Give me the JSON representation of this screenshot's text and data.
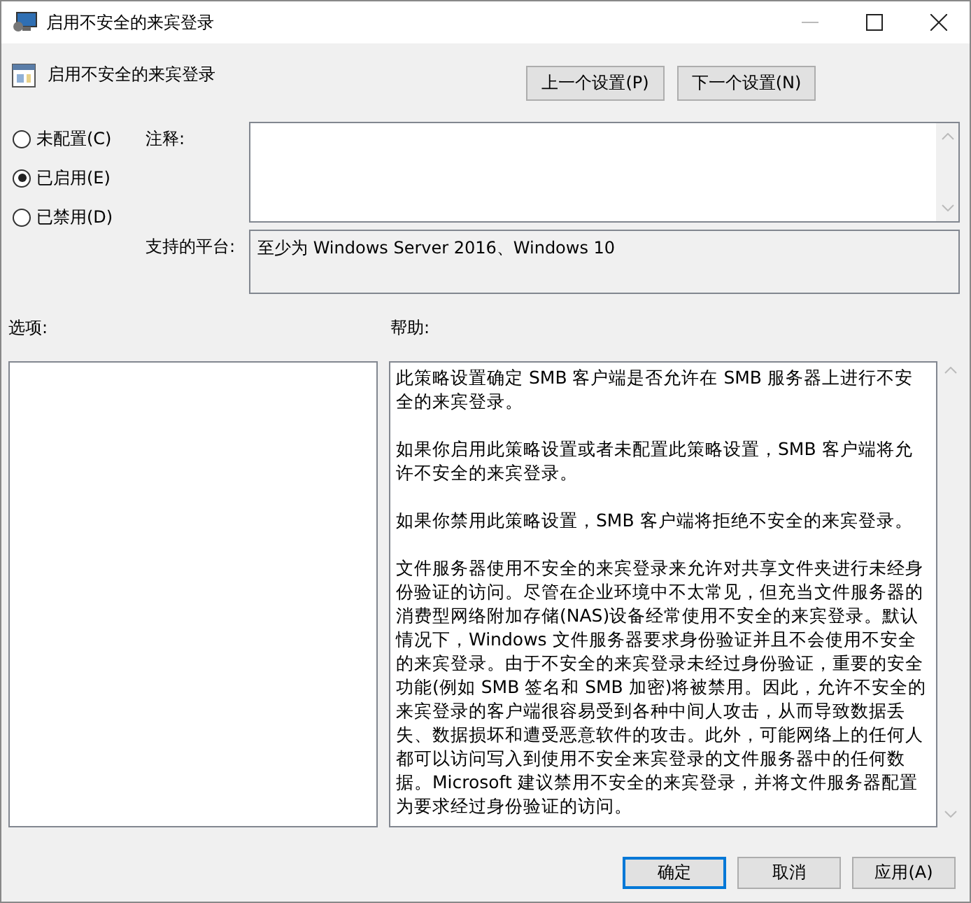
{
  "window": {
    "title": "启用不安全的来宾登录"
  },
  "header": {
    "title": "启用不安全的来宾登录",
    "buttons": [
      "上一个设置(P)",
      "下一个设置(N)"
    ]
  },
  "state_options": [
    {
      "label": "未配置(C)",
      "selected": false
    },
    {
      "label": "已启用(E)",
      "selected": true
    },
    {
      "label": "已禁用(D)",
      "selected": false
    }
  ],
  "comment": {
    "label": "注释:"
  },
  "platform": {
    "label": "支持的平台:",
    "value": "至少为 Windows Server 2016、Windows 10"
  },
  "options": {
    "label": "选项:"
  },
  "help": {
    "label": "帮助:",
    "paragraphs": [
      "此策略设置确定 SMB 客户端是否允许在 SMB 服务器上进行不安全的来宾登录。",
      "如果你启用此策略设置或者未配置此策略设置，SMB 客户端将允许不安全的来宾登录。",
      "如果你禁用此策略设置，SMB 客户端将拒绝不安全的来宾登录。",
      "文件服务器使用不安全的来宾登录来允许对共享文件夹进行未经身份验证的访问。尽管在企业环境中不太常见，但充当文件服务器的消费型网络附加存储(NAS)设备经常使用不安全的来宾登录。默认情况下，Windows 文件服务器要求身份验证并且不会使用不安全的来宾登录。由于不安全的来宾登录未经过身份验证，重要的安全功能(例如 SMB 签名和 SMB 加密)将被禁用。因此，允许不安全的来宾登录的客户端很容易受到各种中间人攻击，从而导致数据丢失、数据损坏和遭受恶意软件的攻击。此外，可能网络上的任何人都可以访问写入到使用不安全来宾登录的文件服务器中的任何数据。Microsoft 建议禁用不安全的来宾登录，并将文件服务器配置为要求经过身份验证的访问。"
    ]
  },
  "footer_buttons": [
    "确定",
    "取消",
    "应用(A)"
  ]
}
